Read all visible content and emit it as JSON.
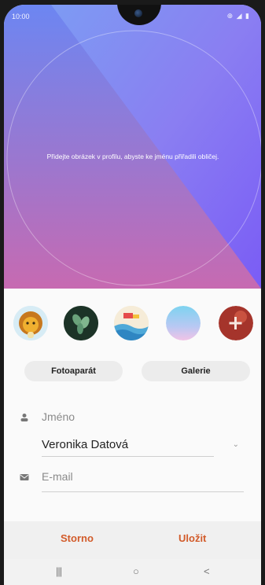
{
  "status_bar": {
    "time": "10:00",
    "icons": "⊕ ◢ ▮"
  },
  "photo": {
    "hint": "Přidejte obrázek v profilu, abyste ke jménu přiřadili obličej."
  },
  "avatars": [
    {
      "icon": "lion-icon"
    },
    {
      "icon": "leaves-icon"
    },
    {
      "icon": "beach-icon"
    },
    {
      "icon": "sky-gradient-icon"
    },
    {
      "icon": "add-photo-icon"
    }
  ],
  "buttons": {
    "camera": "Fotoaparát",
    "gallery": "Galerie"
  },
  "form": {
    "name_label": "Jméno",
    "name_value": "Veronika Datová",
    "email_placeholder": "E-mail"
  },
  "actions": {
    "cancel": "Storno",
    "save": "Uložit"
  },
  "nav": {
    "recent": "|||",
    "home": "○",
    "back": "<"
  },
  "colors": {
    "accent": "#d25b2a",
    "gradient_top_left": "#6f8ff3",
    "gradient_bottom_left": "#c66ab4",
    "gradient_right": "#7a5cf5"
  }
}
